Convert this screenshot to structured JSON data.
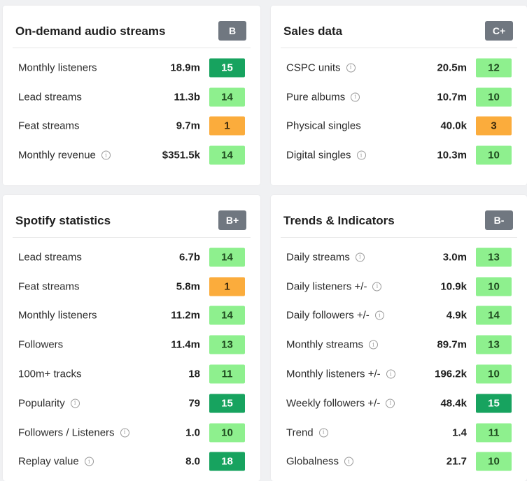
{
  "colors": {
    "light_green": "#8ef08e",
    "dark_green": "#17a35f",
    "orange": "#fbac3c",
    "grade_bg": "#707780"
  },
  "cards": {
    "audio": {
      "title": "On-demand audio streams",
      "grade": "B",
      "rows": [
        {
          "label": "Monthly listeners",
          "info": false,
          "value": "18.9m",
          "score": "15",
          "tone": "dark"
        },
        {
          "label": "Lead streams",
          "info": false,
          "value": "11.3b",
          "score": "14",
          "tone": "light"
        },
        {
          "label": "Feat streams",
          "info": false,
          "value": "9.7m",
          "score": "1",
          "tone": "orange"
        },
        {
          "label": "Monthly revenue",
          "info": true,
          "value": "$351.5k",
          "score": "14",
          "tone": "light"
        }
      ]
    },
    "sales": {
      "title": "Sales data",
      "grade": "C+",
      "rows": [
        {
          "label": "CSPC units",
          "info": true,
          "value": "20.5m",
          "score": "12",
          "tone": "light"
        },
        {
          "label": "Pure albums",
          "info": true,
          "value": "10.7m",
          "score": "10",
          "tone": "light"
        },
        {
          "label": "Physical singles",
          "info": false,
          "value": "40.0k",
          "score": "3",
          "tone": "orange"
        },
        {
          "label": "Digital singles",
          "info": true,
          "value": "10.3m",
          "score": "10",
          "tone": "light"
        }
      ]
    },
    "spotify": {
      "title": "Spotify statistics",
      "grade": "B+",
      "rows": [
        {
          "label": "Lead streams",
          "info": false,
          "value": "6.7b",
          "score": "14",
          "tone": "light"
        },
        {
          "label": "Feat streams",
          "info": false,
          "value": "5.8m",
          "score": "1",
          "tone": "orange"
        },
        {
          "label": "Monthly listeners",
          "info": false,
          "value": "11.2m",
          "score": "14",
          "tone": "light"
        },
        {
          "label": "Followers",
          "info": false,
          "value": "11.4m",
          "score": "13",
          "tone": "light"
        },
        {
          "label": "100m+ tracks",
          "info": false,
          "value": "18",
          "score": "11",
          "tone": "light"
        },
        {
          "label": "Popularity",
          "info": true,
          "value": "79",
          "score": "15",
          "tone": "dark"
        },
        {
          "label": "Followers / Listeners",
          "info": true,
          "value": "1.0",
          "score": "10",
          "tone": "light"
        },
        {
          "label": "Replay value",
          "info": true,
          "value": "8.0",
          "score": "18",
          "tone": "dark"
        }
      ]
    },
    "trends": {
      "title": "Trends & Indicators",
      "grade": "B-",
      "rows": [
        {
          "label": "Daily streams",
          "info": true,
          "value": "3.0m",
          "score": "13",
          "tone": "light"
        },
        {
          "label": "Daily listeners +/-",
          "info": true,
          "value": "10.9k",
          "score": "10",
          "tone": "light"
        },
        {
          "label": "Daily followers +/-",
          "info": true,
          "value": "4.9k",
          "score": "14",
          "tone": "light"
        },
        {
          "label": "Monthly streams",
          "info": true,
          "value": "89.7m",
          "score": "13",
          "tone": "light"
        },
        {
          "label": "Monthly listeners +/-",
          "info": true,
          "value": "196.2k",
          "score": "10",
          "tone": "light"
        },
        {
          "label": "Weekly followers +/-",
          "info": true,
          "value": "48.4k",
          "score": "15",
          "tone": "dark"
        },
        {
          "label": "Trend",
          "info": true,
          "value": "1.4",
          "score": "11",
          "tone": "light"
        },
        {
          "label": "Globalness",
          "info": true,
          "value": "21.7",
          "score": "10",
          "tone": "light"
        }
      ]
    }
  }
}
